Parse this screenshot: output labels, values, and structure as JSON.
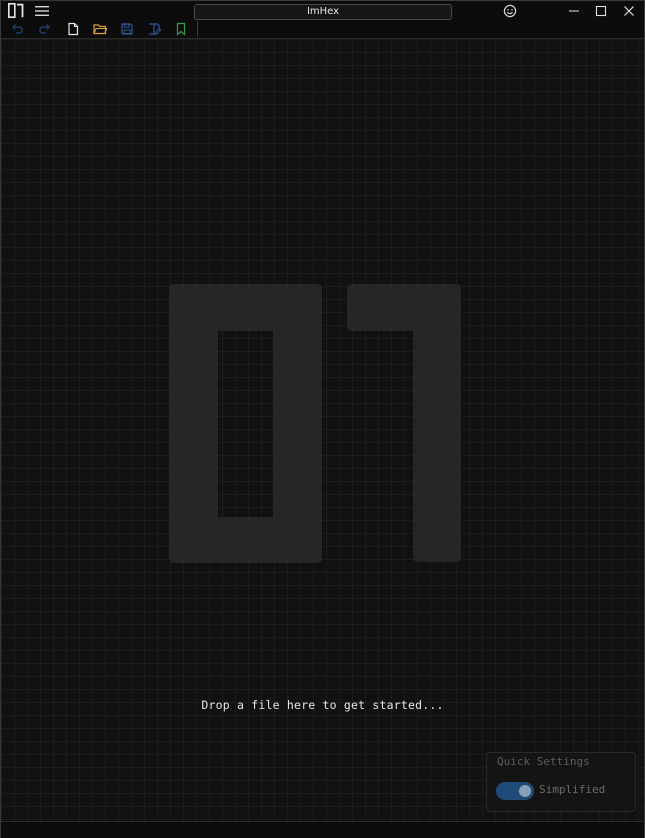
{
  "app": {
    "title": "ImHex"
  },
  "titlebar": {
    "icons": [
      "app-logo",
      "menu-icon",
      "smiley-icon",
      "minimize-icon",
      "maximize-icon",
      "close-icon"
    ]
  },
  "toolbar": {
    "icons": [
      "undo-icon",
      "redo-icon",
      "new-file-icon",
      "open-folder-icon",
      "save-icon",
      "save-as-icon",
      "bookmark-icon"
    ]
  },
  "welcome": {
    "logo_text": "01",
    "drop_message": "Drop a file here to get started..."
  },
  "quick_settings": {
    "title": "Quick Settings",
    "toggle_label": "Simplified",
    "toggle_on": true
  },
  "colors": {
    "accent": "#1f4a7a",
    "folder": "#d8a23a",
    "bookmark": "#3b9a4a",
    "save": "#2a5a9a"
  }
}
